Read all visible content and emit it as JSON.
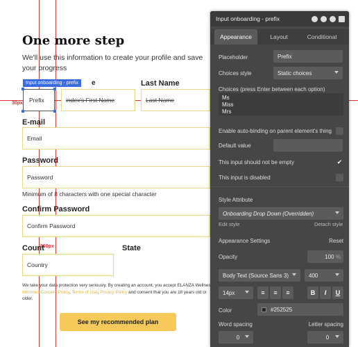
{
  "form": {
    "title": "One more step",
    "subtitle": "We'll use this information to create your profile and save your progress",
    "selection_badge": "Input onboarding - prefix",
    "first_name_label_tail": "e",
    "last_name_label": "Last Name",
    "prefix_value": "Prefix",
    "first_name_placeholder": "index's First Name",
    "last_name_placeholder": "Last Name",
    "email_label": "E-mail",
    "email_placeholder": "Email",
    "password_label": "Password",
    "password_placeholder": "Password",
    "password_hint": "Minimum of 8 characters with one special character",
    "confirm_label": "Confirm Password",
    "confirm_placeholder": "Confirm Password",
    "country_label": "Count",
    "state_label": "State",
    "country_placeholder": "Country",
    "legal_part1": "We take your data protection very seriously. By creating an account, you accept ELANZA Wellness's ",
    "legal_link1": "Informed Consent Policy",
    "legal_sep1": ", ",
    "legal_link2": "Terms of Use",
    "legal_sep2": ", ",
    "legal_link3": "Privacy Policy",
    "legal_part2": " and consent that you are 18 years old or older.",
    "cta_label": "See my recommended plan"
  },
  "guides": {
    "left_margin_label": "30px",
    "right_label": "960px"
  },
  "panel": {
    "title": "Input onboarding - prefix",
    "tabs": [
      "Appearance",
      "Layout",
      "Conditional"
    ],
    "placeholder_label": "Placeholder",
    "placeholder_value": "Prefix",
    "choices_style_label": "Choices style",
    "choices_style_value": "Static choices",
    "choices_label": "Choices (press Enter between each option)",
    "choices": [
      "Ms",
      "Miss",
      "Mrs"
    ],
    "autobinding_label": "Enable auto-binding on parent element's thing",
    "default_value_label": "Default value",
    "not_empty_label": "This input should not be empty",
    "disabled_label": "This input is disabled",
    "style_attribute_label": "Style Attribute",
    "style_value": "Onboarding Drop Down (Overridden)",
    "edit_style": "Edit style",
    "detach_style": "Detach style",
    "appearance_settings": "Appearance Settings",
    "reset": "Reset",
    "opacity_label": "Opacity",
    "opacity_value": "100",
    "opacity_unit": "%",
    "font_value": "Body Text (Source Sans 3)",
    "weight_value": "400",
    "size_value": "14px",
    "bold": "B",
    "italic": "I",
    "underline": "U",
    "color_label": "Color",
    "color_value": "#252525",
    "word_spacing_label": "Word spacing",
    "letter_spacing_label": "Letter spacing",
    "word_spacing_value": "0",
    "letter_spacing_value": "0",
    "not_empty_checked": true
  }
}
